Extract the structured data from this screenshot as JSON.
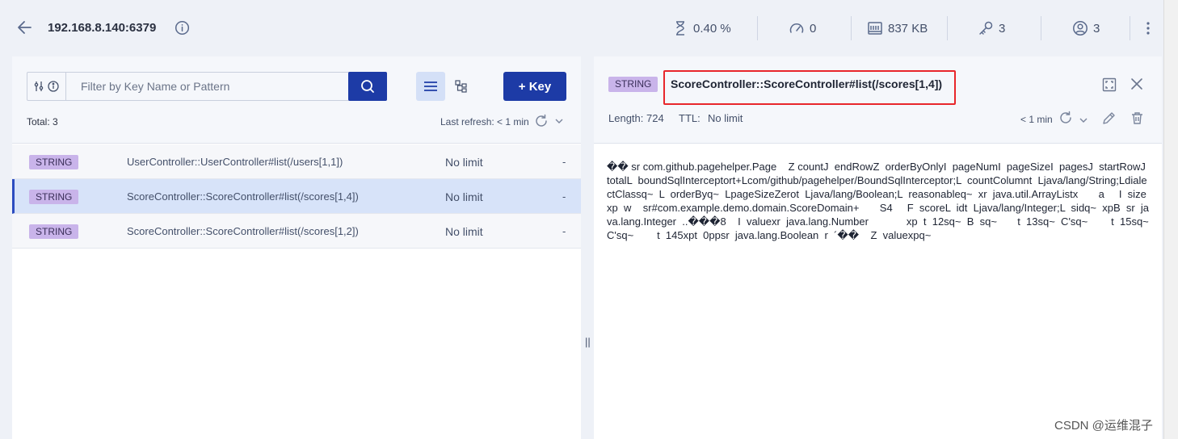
{
  "header": {
    "host": "192.168.8.140:6379",
    "stats": {
      "cpu": "0.40 %",
      "ops": "0",
      "memory": "837 KB",
      "keys": "3",
      "clients": "3"
    }
  },
  "browser": {
    "search_placeholder": "Filter by Key Name or Pattern",
    "add_key_label": "+ Key",
    "total": "Total: 3",
    "last_refresh": "Last refresh: < 1 min",
    "rows": [
      {
        "type": "STRING",
        "key": "UserController::UserController#list(/users[1,1])",
        "ttl": "No limit",
        "size": "-"
      },
      {
        "type": "STRING",
        "key": "ScoreController::ScoreController#list(/scores[1,4])",
        "ttl": "No limit",
        "size": "-"
      },
      {
        "type": "STRING",
        "key": "ScoreController::ScoreController#list(/scores[1,2])",
        "ttl": "No limit",
        "size": "-"
      }
    ]
  },
  "details": {
    "type": "STRING",
    "key": "ScoreController::ScoreController#list(/scores[1,4])",
    "length": "Length: 724",
    "ttl_label": "TTL:",
    "ttl_value": "No limit",
    "refresh_time": "< 1 min",
    "value": "�� sr com.github.pagehelper.Page    Z countJ  endRowZ  orderByOnlyI  pageNumI  pageSizeI  pagesJ  startRowJ  totalL  boundSqlInterceptort+Lcom/github/pagehelper/BoundSqlInterceptor;L  countColumnt  Ljava/lang/String;LdialectClassq~  L  orderByq~  LpageSizeZerot  Ljava/lang/Boolean;L  reasonableq~  xr  java.util.ArrayListx       a     I  sizexp  w    sr#com.example.demo.domain.ScoreDomain+       S4     F  scoreL  idt  Ljava/lang/Integer;L  sidq~  xpB  sr  java.lang.Integer  ..���8    I  valuexr  java.lang.Number             xp  t  12sq~  B  sq~       t  13sq~  C'sq~        t  15sq~  C'sq~        t  145xpt  0ppsr  java.lang.Boolean  r  ´��    Z  valuexpq~"
  },
  "divider": "||",
  "watermark": "CSDN @运维混子"
}
